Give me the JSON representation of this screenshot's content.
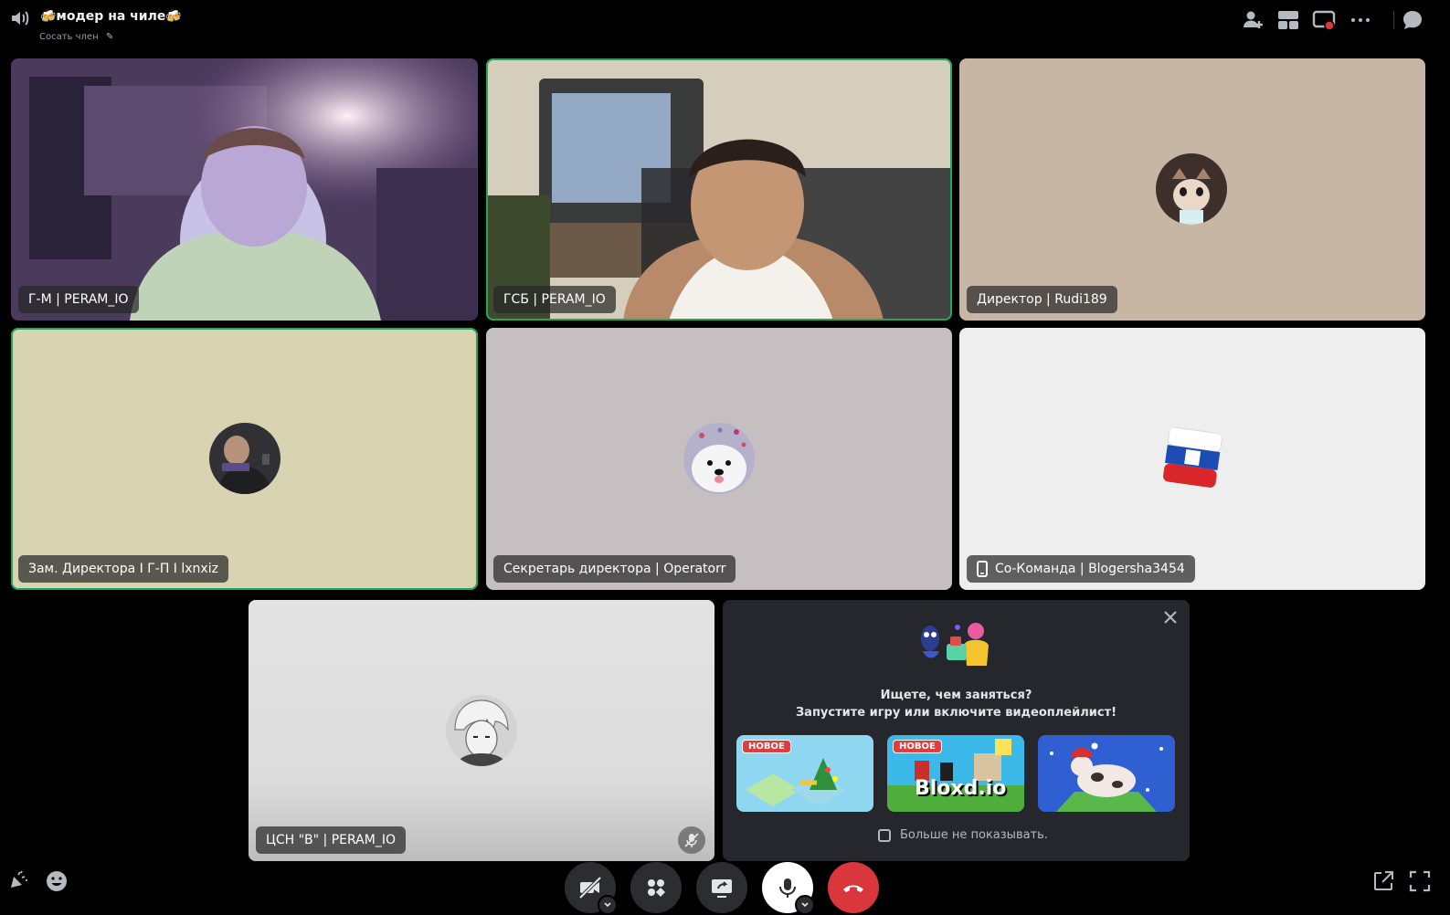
{
  "header": {
    "title": "🍻модер на чиле🍻",
    "subtitle": "Сосать член"
  },
  "tiles": [
    {
      "name": "Г-М | PERAM_IO",
      "kind": "video",
      "speaking": false
    },
    {
      "name": "ГСБ | PERAM_IO",
      "kind": "video",
      "speaking": true
    },
    {
      "name": "Директор | Rudi189",
      "kind": "avatar",
      "speaking": false,
      "bg": "#c8b6a4"
    },
    {
      "name": "Зам. Директора I Г-П I lxnxiz",
      "kind": "avatar",
      "speaking": true,
      "bg": "#d8d4b2"
    },
    {
      "name": "Секретарь директора | Operatorr",
      "kind": "avatar",
      "speaking": false,
      "bg": "#c6bfc1"
    },
    {
      "name": "Со-Команда | Blogersha3454",
      "kind": "avatar",
      "speaking": false,
      "bg": "#eeeeef",
      "mobile": true
    },
    {
      "name": "ЦСН \"В\" | PERAM_IO",
      "kind": "avatar",
      "speaking": false,
      "bg": "#e3e3e3",
      "muted": true
    }
  ],
  "activity_panel": {
    "title": "Ищете, чем заняться?",
    "subtitle": "Запустите игру или включите видеоплейлист!",
    "games": [
      {
        "badge": "НОВОЕ",
        "title": ""
      },
      {
        "badge": "НОВОЕ",
        "title": "Bloxd.io"
      },
      {
        "badge": "",
        "title": ""
      }
    ],
    "dont_show": "Больше не показывать."
  },
  "colors": {
    "speaking_outline": "#23a55a",
    "leave_button": "#da373c",
    "panel_bg": "#26272c"
  },
  "icons": [
    "speaker-icon",
    "pencil-icon",
    "add-person-icon",
    "grid-layout-icon",
    "screen-record-icon",
    "more-icon",
    "chat-icon",
    "close-icon",
    "camera-off-icon",
    "activities-icon",
    "screen-share-icon",
    "microphone-icon",
    "hangup-icon",
    "soundboard-icon",
    "emoji-icon",
    "popout-icon",
    "fullscreen-icon",
    "muted-mic-icon",
    "mobile-phone-icon"
  ]
}
